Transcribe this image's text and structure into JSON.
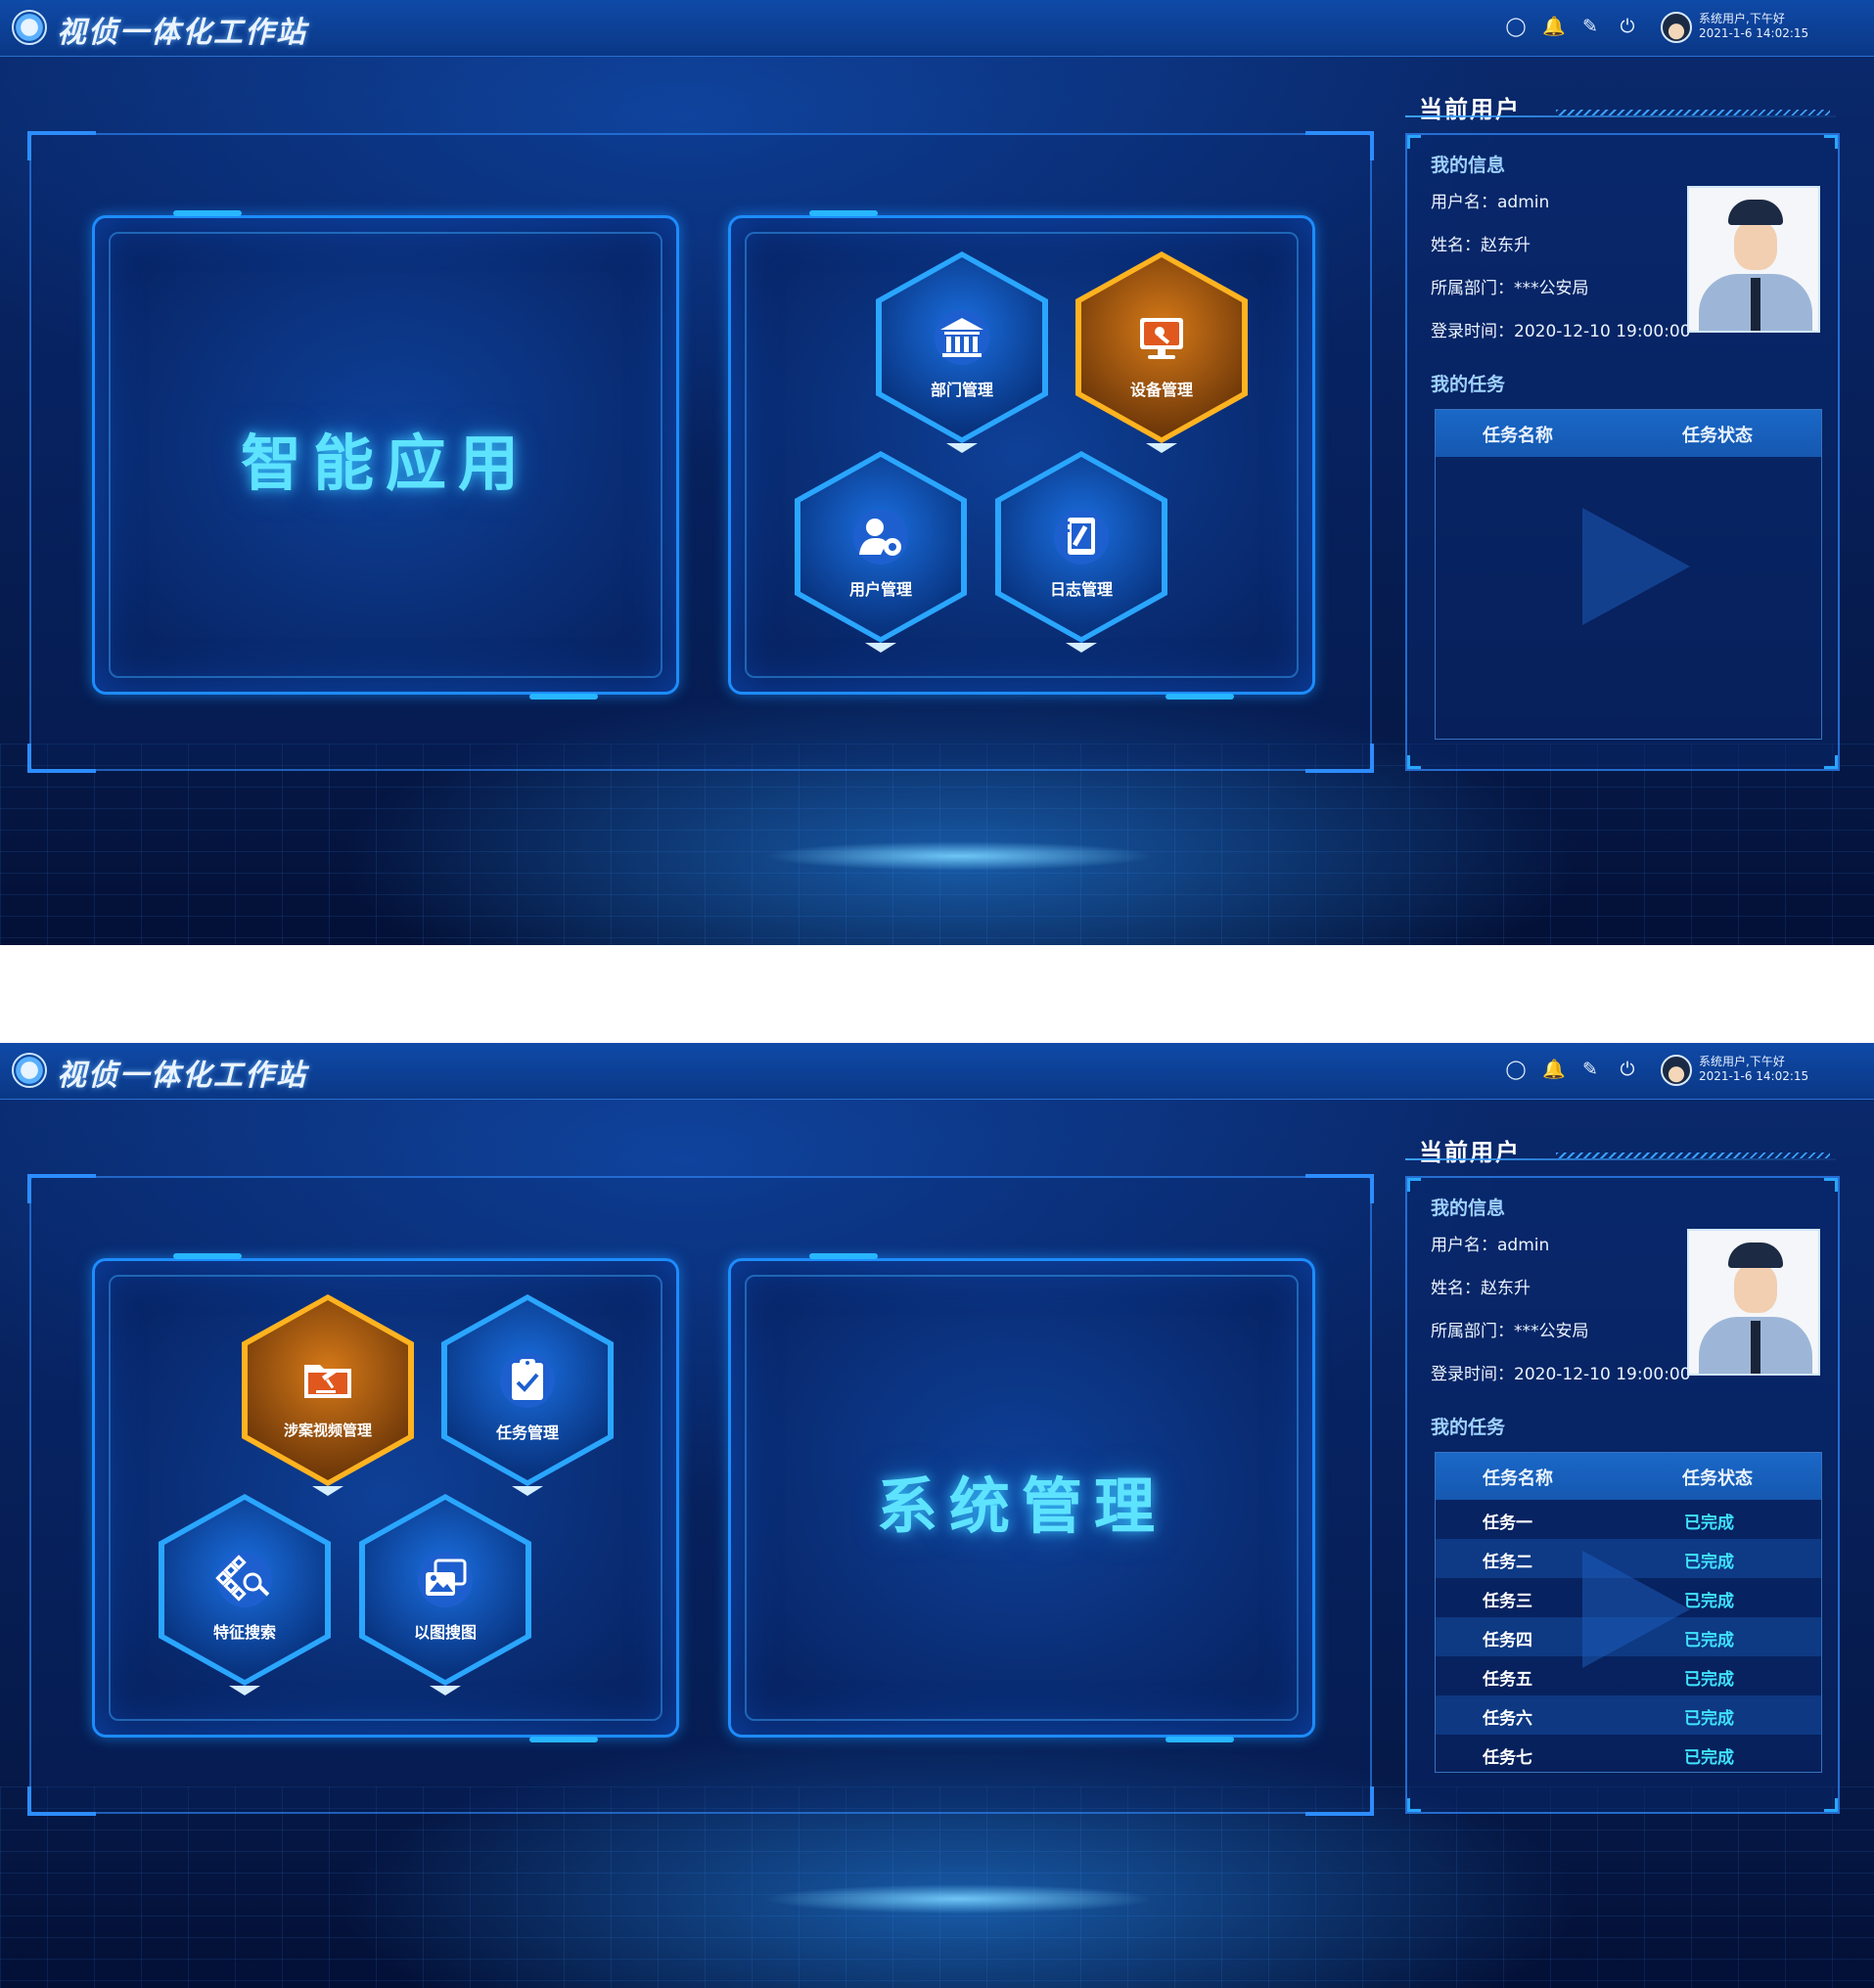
{
  "app": {
    "title": "视侦一体化工作站"
  },
  "topbar": {
    "icons": [
      "user-circle-icon",
      "bell-icon",
      "edit-icon",
      "power-icon"
    ],
    "greeting": "系统用户,下午好",
    "datetime": "2021-1-6 14:02:15"
  },
  "screens": [
    {
      "left_panel": {
        "title": "智能应用"
      },
      "right_panel": {
        "tiles": [
          {
            "label": "部门管理",
            "icon": "building-icon",
            "style": "blue"
          },
          {
            "label": "设备管理",
            "icon": "wrench-screen-icon",
            "style": "gold"
          },
          {
            "label": "用户管理",
            "icon": "user-gear-icon",
            "style": "blue"
          },
          {
            "label": "日志管理",
            "icon": "notebook-pen-icon",
            "style": "blue"
          }
        ]
      }
    },
    {
      "left_panel": {
        "tiles": [
          {
            "label": "涉案视频管理",
            "icon": "folder-gavel-icon",
            "style": "gold"
          },
          {
            "label": "任务管理",
            "icon": "clipboard-check-icon",
            "style": "blue"
          },
          {
            "label": "特征搜索",
            "icon": "grid-search-icon",
            "style": "blue"
          },
          {
            "label": "以图搜图",
            "icon": "image-stack-icon",
            "style": "blue"
          }
        ]
      },
      "right_panel": {
        "title": "系统管理"
      }
    }
  ],
  "side": {
    "title": "当前用户",
    "info_title": "我的信息",
    "username": "用户名：admin",
    "name": "姓名：赵东升",
    "department": "所属部门：***公安局",
    "login_time": "登录时间：2020-12-10 19:00:00",
    "tasks_title": "我的任务",
    "col_name": "任务名称",
    "col_status": "任务状态",
    "tasks": [
      {
        "name": "任务一",
        "status": "已完成"
      },
      {
        "name": "任务二",
        "status": "已完成"
      },
      {
        "name": "任务三",
        "status": "已完成"
      },
      {
        "name": "任务四",
        "status": "已完成"
      },
      {
        "name": "任务五",
        "status": "已完成"
      },
      {
        "name": "任务六",
        "status": "已完成"
      },
      {
        "name": "任务七",
        "status": "已完成"
      }
    ]
  },
  "colors": {
    "accent": "#2aa6ff",
    "gold": "#ffb320",
    "status": "#3fe2ff",
    "title_glow": "#5ee3ff"
  }
}
